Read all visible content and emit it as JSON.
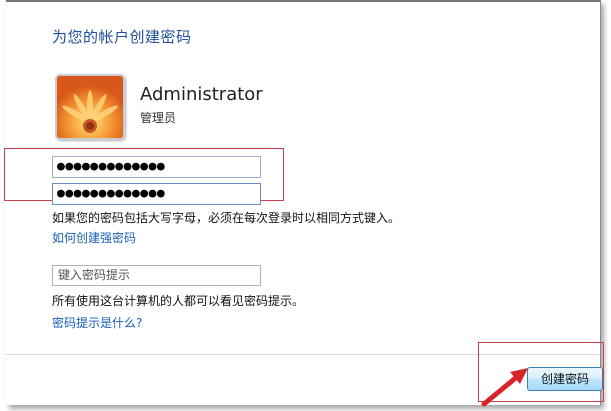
{
  "dialog": {
    "title": "为您的帐户创建密码"
  },
  "account": {
    "name": "Administrator",
    "role": "管理员",
    "avatar_icon": "flower-avatar-icon"
  },
  "password": {
    "field1_value": "●●●●●●●●●●●●●",
    "field2_value": "●●●●●●●●●●●●●",
    "case_notice": "如果您的密码包括大写字母，必须在每次登录时以相同方式键入。",
    "strong_link": "如何创建强密码"
  },
  "hint": {
    "placeholder": "键入密码提示",
    "visibility_notice": "所有使用这台计算机的人都可以看见密码提示。",
    "what_link": "密码提示是什么?"
  },
  "footer": {
    "create_button": "创建密码"
  },
  "colors": {
    "title_blue": "#1f4f9e",
    "link_blue": "#1c5fb8",
    "annotation_red": "#c4414d"
  }
}
